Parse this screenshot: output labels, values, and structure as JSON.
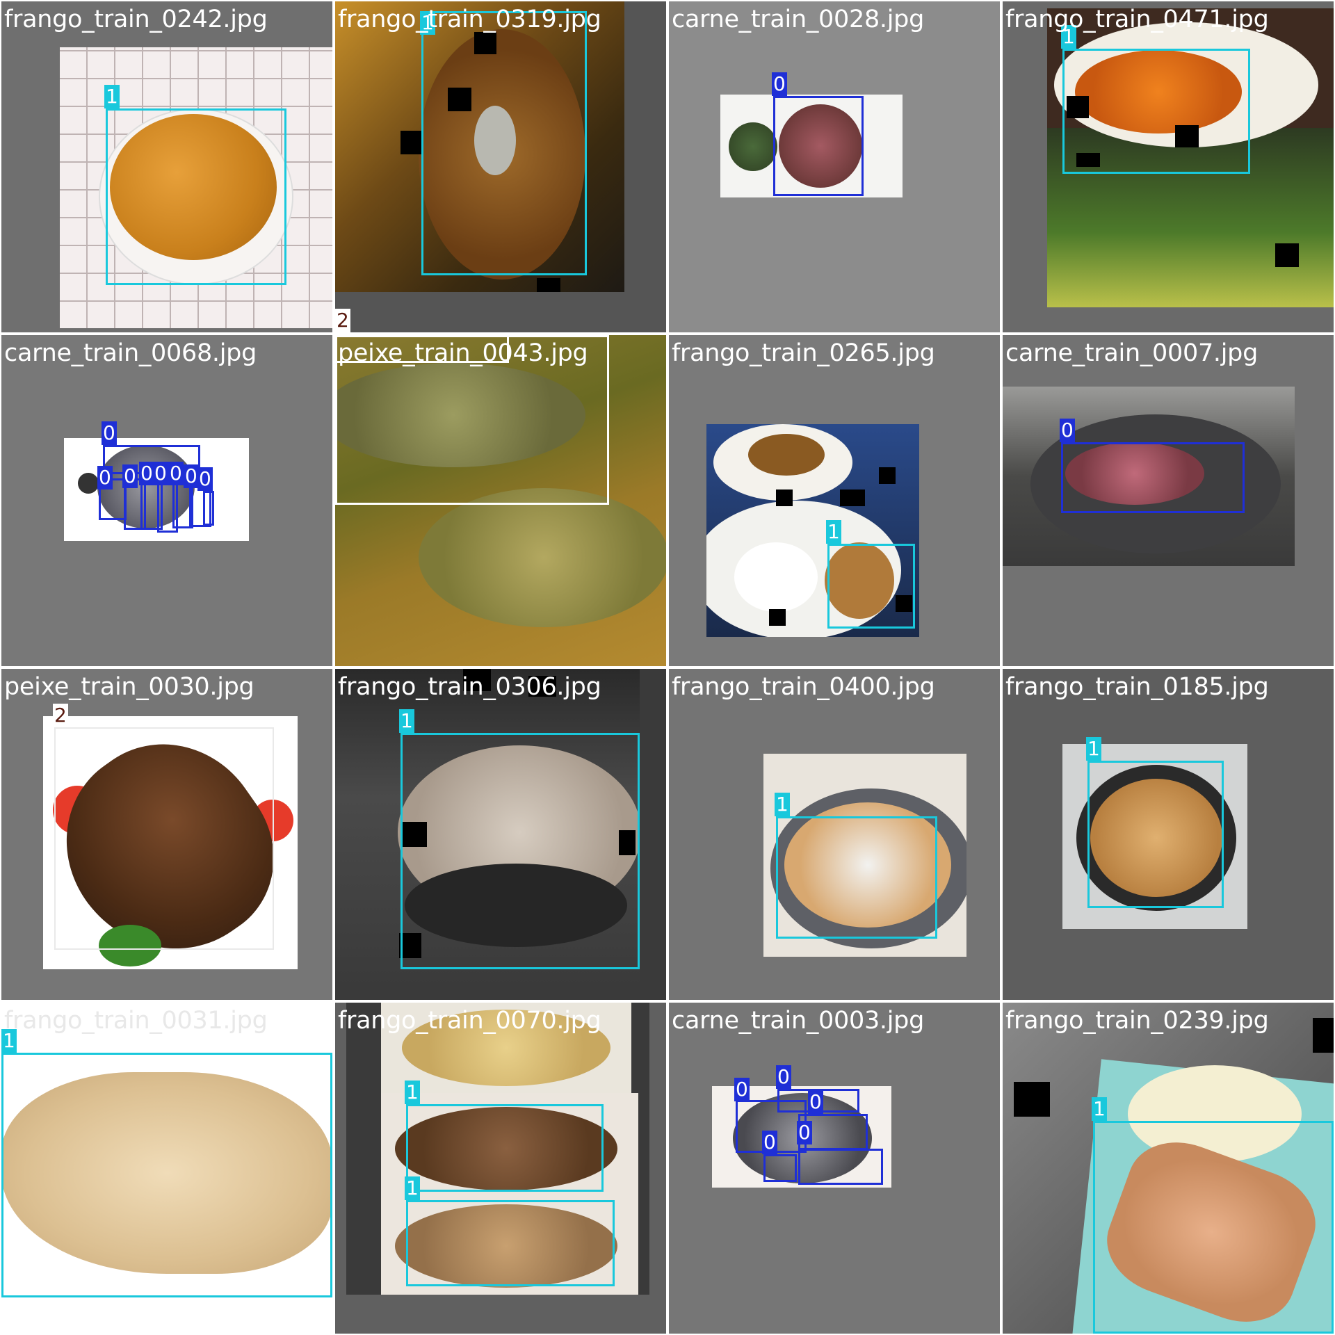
{
  "grid": {
    "columns": 4,
    "rows": 4
  },
  "class_colors": {
    "0": "#1f2fd6",
    "1": "#19c8dc",
    "2": "#ffffff"
  },
  "tiles": [
    {
      "filename": "frango_train_0242.jpg",
      "labels": [
        "1"
      ]
    },
    {
      "filename": "frango_train_0319.jpg",
      "labels": [
        "1",
        "2"
      ]
    },
    {
      "filename": "carne_train_0028.jpg",
      "labels": [
        "0"
      ]
    },
    {
      "filename": "frango_train_0471.jpg",
      "labels": [
        "1"
      ]
    },
    {
      "filename": "carne_train_0068.jpg",
      "labels": [
        "0",
        "0",
        "0",
        "0",
        "0",
        "0",
        "0",
        "0"
      ]
    },
    {
      "filename": "peixe_train_0043.jpg",
      "labels": []
    },
    {
      "filename": "frango_train_0265.jpg",
      "labels": [
        "1"
      ]
    },
    {
      "filename": "carne_train_0007.jpg",
      "labels": [
        "0"
      ]
    },
    {
      "filename": "peixe_train_0030.jpg",
      "labels": [
        "2"
      ]
    },
    {
      "filename": "frango_train_0306.jpg",
      "labels": [
        "1"
      ]
    },
    {
      "filename": "frango_train_0400.jpg",
      "labels": [
        "1"
      ]
    },
    {
      "filename": "frango_train_0185.jpg",
      "labels": [
        "1"
      ]
    },
    {
      "filename": "frango_train_0031.jpg",
      "labels": [
        "1"
      ]
    },
    {
      "filename": "frango_train_0070.jpg",
      "labels": [
        "1",
        "1"
      ]
    },
    {
      "filename": "carne_train_0003.jpg",
      "labels": [
        "0",
        "0",
        "0",
        "0",
        "0"
      ]
    },
    {
      "filename": "frango_train_0239.jpg",
      "labels": [
        "1"
      ]
    }
  ]
}
